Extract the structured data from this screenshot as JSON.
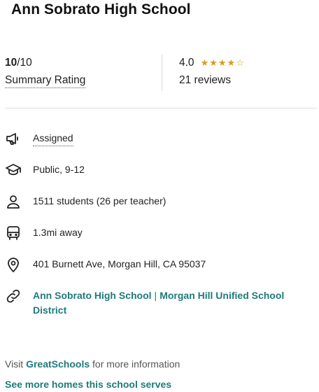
{
  "school": {
    "name": "Ann Sobrato High School"
  },
  "rating": {
    "score": "10",
    "out_of": "/10",
    "label": "Summary Rating"
  },
  "reviews": {
    "average": "4.0",
    "stars": [
      "star-full",
      "star-full",
      "star-full",
      "star-full",
      "star-empty"
    ],
    "count_text": "21 reviews",
    "star_color": "#d79b1e"
  },
  "details": {
    "assigned": "Assigned",
    "type": "Public, 9-12",
    "students": "1511 students (26 per teacher)",
    "distance": "1.3mi away",
    "address": "401 Burnett Ave, Morgan Hill, CA 95037",
    "link_school": "Ann Sobrato High School",
    "link_separator": "|",
    "link_district": "Morgan Hill Unified School District"
  },
  "footer": {
    "visit_prefix": "Visit",
    "visit_link": "GreatSchools",
    "visit_suffix": "for more information",
    "see_more": "See more homes this school serves"
  },
  "colors": {
    "link": "#1f7a7a",
    "divider": "#e0e0e0"
  }
}
